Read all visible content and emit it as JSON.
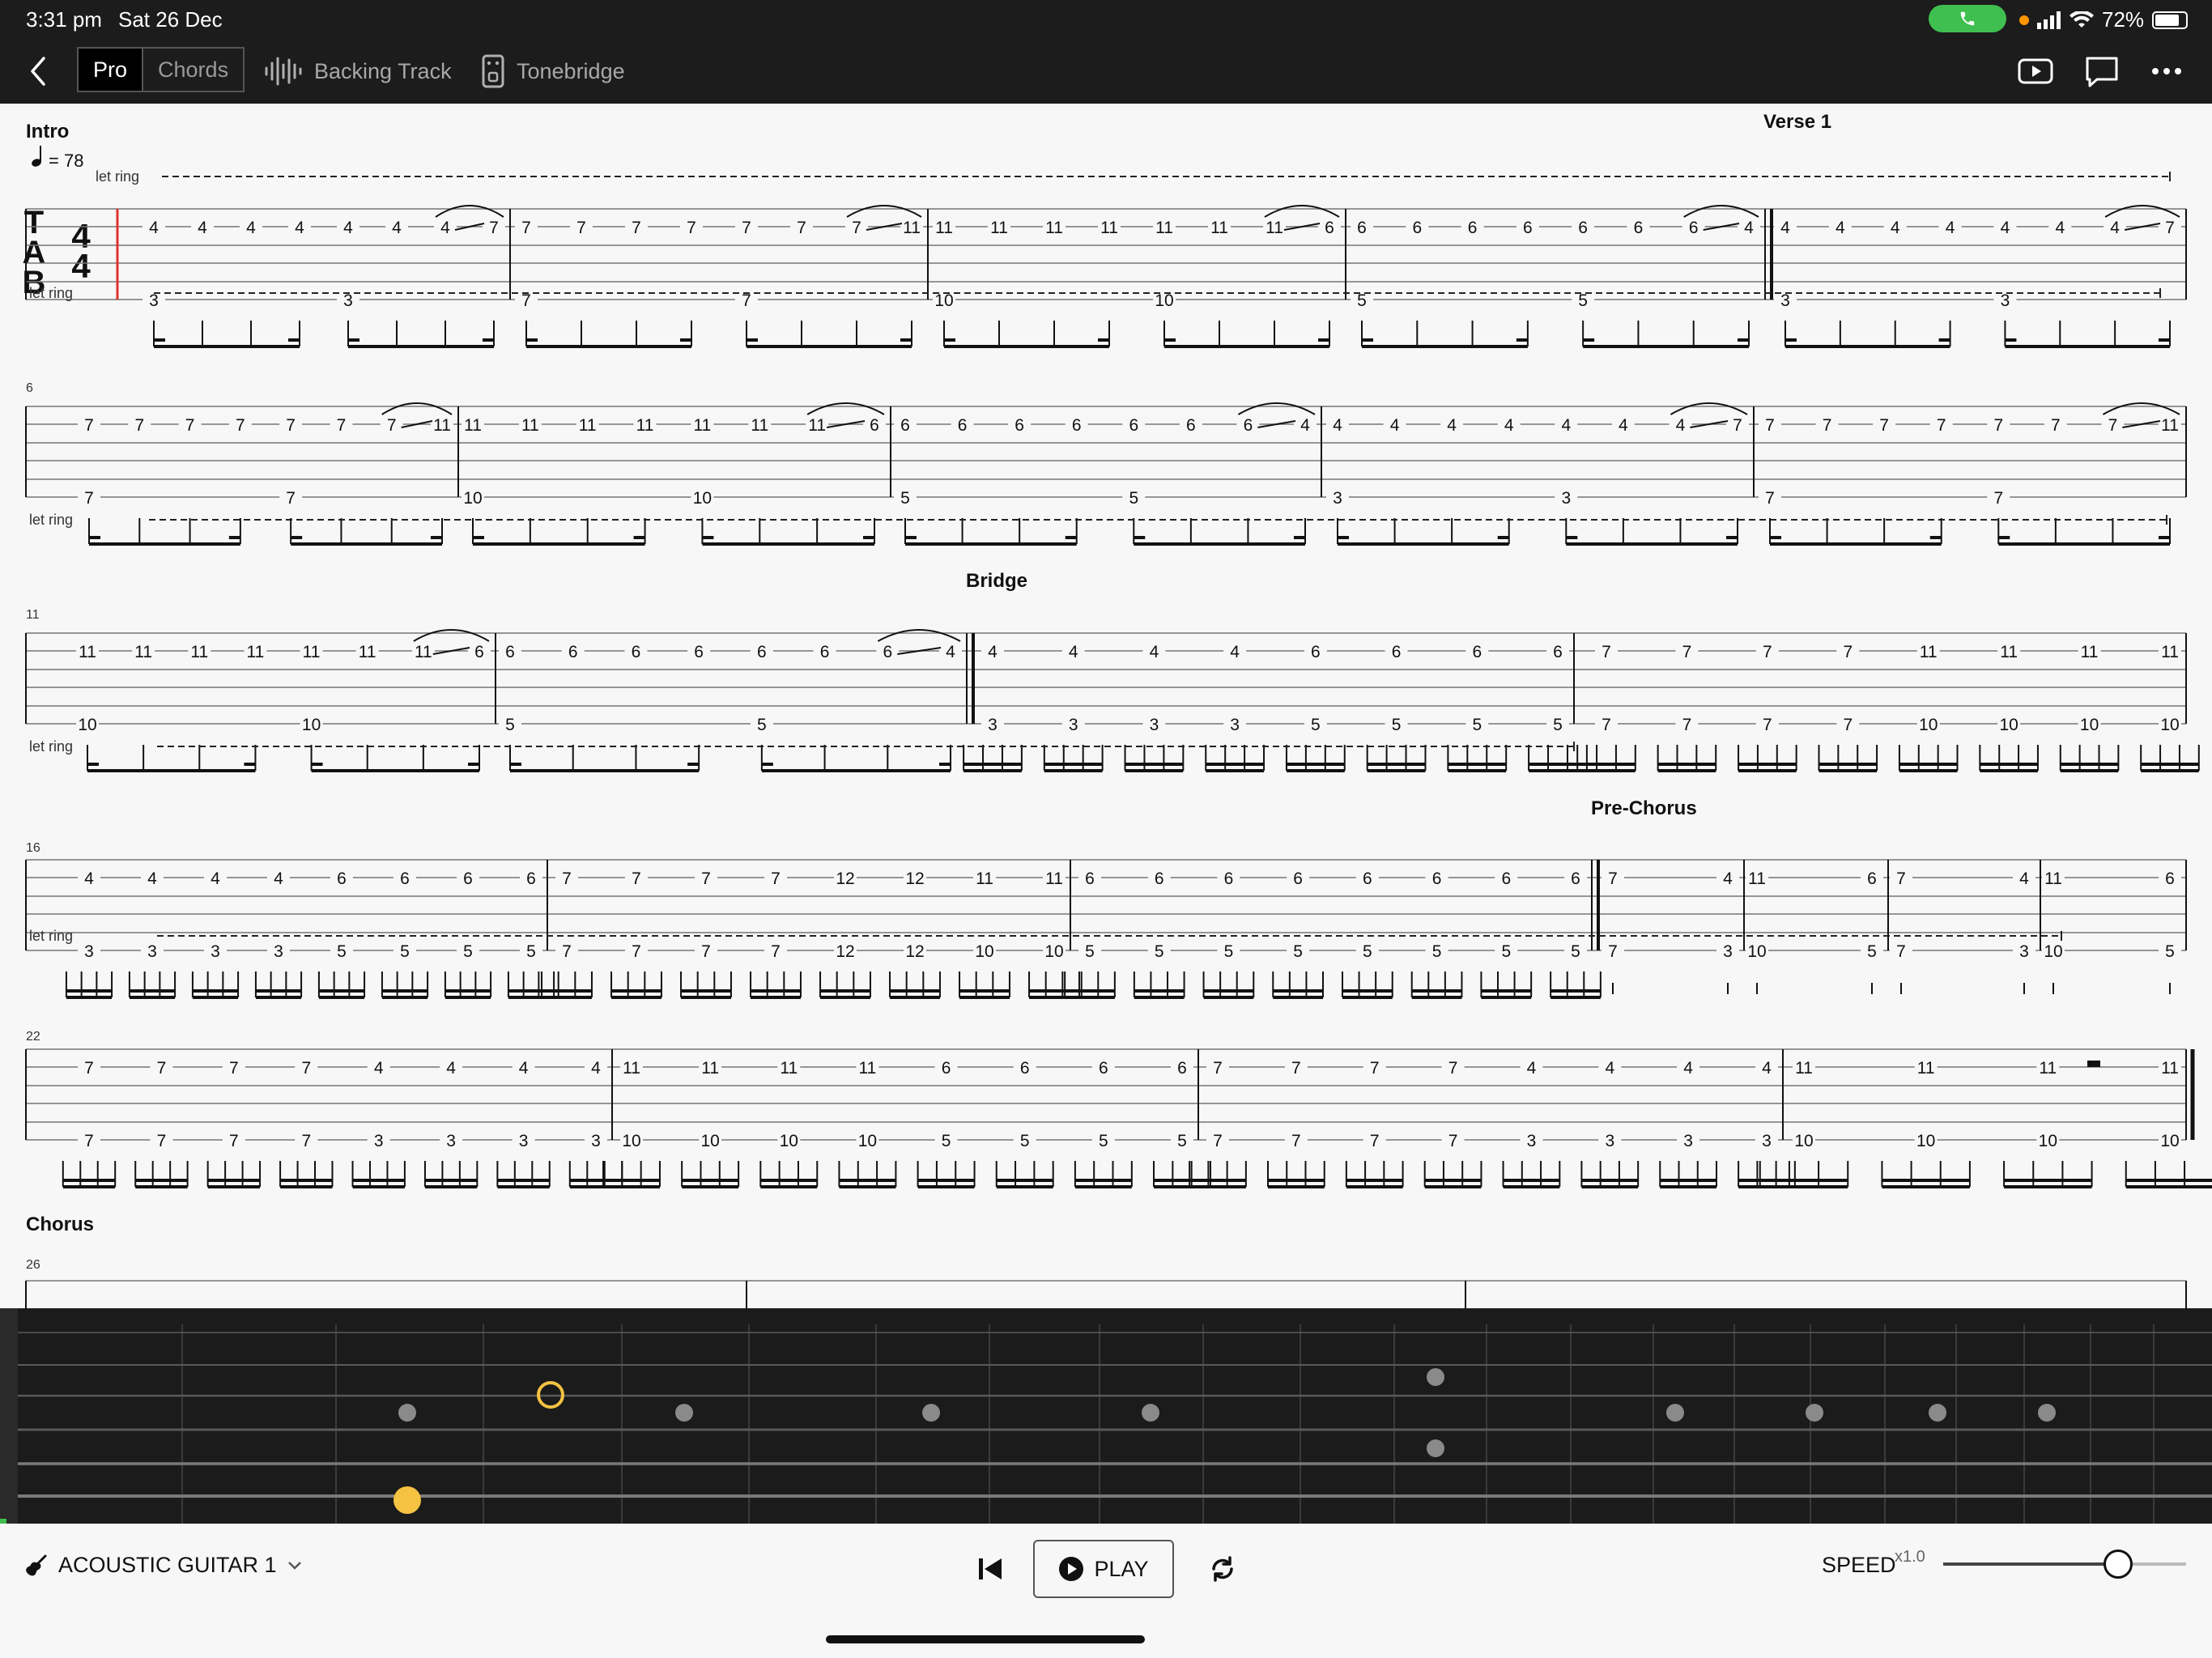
{
  "status_bar": {
    "time": "3:31 pm",
    "date": "Sat 26 Dec",
    "battery": "72%",
    "battery_level": 0.72
  },
  "toolbar": {
    "tabs": [
      {
        "label": "Pro",
        "active": true
      },
      {
        "label": "Chords",
        "active": false
      }
    ],
    "backing_track": "Backing Track",
    "tonebridge": "Tonebridge"
  },
  "icons": [
    "back-icon",
    "waveform-icon",
    "pedal-icon",
    "video-icon",
    "comment-icon",
    "more-icon",
    "phone-icon",
    "wifi-icon",
    "signal-icon",
    "guitar-icon",
    "chevron-down-icon",
    "skip-back-icon",
    "play-icon",
    "loop-icon"
  ],
  "colors": {
    "bar_bg": "#1c1c1c",
    "accent_yellow": "#f5c242",
    "cursor_red": "#e0322d",
    "call_green": "#3fbf4f",
    "page_bg": "#f7f7f7"
  },
  "score": {
    "tempo": "= 78",
    "let_ring": "let ring",
    "tab_clef": [
      "T",
      "A",
      "B"
    ],
    "time_signature": [
      "4",
      "4"
    ],
    "sections": [
      "Intro",
      "Verse 1",
      "Bridge",
      "Pre-Chorus",
      "Chorus"
    ],
    "measure_numbers": [
      "6",
      "11",
      "16",
      "22",
      "26"
    ],
    "systems": [
      {
        "measures": [
          {
            "beats": [
              [
                "4",
                "3"
              ],
              [
                "4",
                ""
              ],
              [
                "4",
                ""
              ],
              [
                "4",
                ""
              ],
              [
                "4",
                "3"
              ],
              [
                "4",
                ""
              ],
              [
                "4",
                ""
              ],
              [
                "7",
                ""
              ]
            ],
            "slide": true
          },
          {
            "beats": [
              [
                "7",
                "7"
              ],
              [
                "7",
                ""
              ],
              [
                "7",
                ""
              ],
              [
                "7",
                ""
              ],
              [
                "7",
                "7"
              ],
              [
                "7",
                ""
              ],
              [
                "7",
                ""
              ],
              [
                "11",
                ""
              ]
            ],
            "slide": true
          },
          {
            "beats": [
              [
                "11",
                "10"
              ],
              [
                "11",
                ""
              ],
              [
                "11",
                ""
              ],
              [
                "11",
                ""
              ],
              [
                "11",
                "10"
              ],
              [
                "11",
                ""
              ],
              [
                "11",
                ""
              ],
              [
                "6",
                ""
              ]
            ],
            "slide": true
          },
          {
            "beats": [
              [
                "6",
                "5"
              ],
              [
                "6",
                ""
              ],
              [
                "6",
                ""
              ],
              [
                "6",
                ""
              ],
              [
                "6",
                "5"
              ],
              [
                "6",
                ""
              ],
              [
                "6",
                ""
              ],
              [
                "4",
                ""
              ]
            ],
            "slide": true
          },
          {
            "beats": [
              [
                "4",
                "3"
              ],
              [
                "4",
                ""
              ],
              [
                "4",
                ""
              ],
              [
                "4",
                ""
              ],
              [
                "4",
                "3"
              ],
              [
                "4",
                ""
              ],
              [
                "4",
                ""
              ],
              [
                "7",
                ""
              ]
            ],
            "slide": true
          }
        ]
      },
      {
        "measures": [
          {
            "beats": [
              [
                "7",
                "7"
              ],
              [
                "7",
                ""
              ],
              [
                "7",
                ""
              ],
              [
                "7",
                ""
              ],
              [
                "7",
                "7"
              ],
              [
                "7",
                ""
              ],
              [
                "7",
                ""
              ],
              [
                "11",
                ""
              ]
            ],
            "slide": true
          },
          {
            "beats": [
              [
                "11",
                "10"
              ],
              [
                "11",
                ""
              ],
              [
                "11",
                ""
              ],
              [
                "11",
                ""
              ],
              [
                "11",
                "10"
              ],
              [
                "11",
                ""
              ],
              [
                "11",
                ""
              ],
              [
                "6",
                ""
              ]
            ],
            "slide": true
          },
          {
            "beats": [
              [
                "6",
                "5"
              ],
              [
                "6",
                ""
              ],
              [
                "6",
                ""
              ],
              [
                "6",
                ""
              ],
              [
                "6",
                "5"
              ],
              [
                "6",
                ""
              ],
              [
                "6",
                ""
              ],
              [
                "4",
                ""
              ]
            ],
            "slide": true
          },
          {
            "beats": [
              [
                "4",
                "3"
              ],
              [
                "4",
                ""
              ],
              [
                "4",
                ""
              ],
              [
                "4",
                ""
              ],
              [
                "4",
                "3"
              ],
              [
                "4",
                ""
              ],
              [
                "4",
                ""
              ],
              [
                "7",
                ""
              ]
            ],
            "slide": true
          },
          {
            "beats": [
              [
                "7",
                "7"
              ],
              [
                "7",
                ""
              ],
              [
                "7",
                ""
              ],
              [
                "7",
                ""
              ],
              [
                "7",
                "7"
              ],
              [
                "7",
                ""
              ],
              [
                "7",
                ""
              ],
              [
                "11",
                ""
              ]
            ],
            "slide": true
          }
        ]
      },
      {
        "measures": [
          {
            "beats": [
              [
                "11",
                "10"
              ],
              [
                "11",
                ""
              ],
              [
                "11",
                ""
              ],
              [
                "11",
                ""
              ],
              [
                "11",
                "10"
              ],
              [
                "11",
                ""
              ],
              [
                "11",
                ""
              ],
              [
                "6",
                ""
              ]
            ],
            "slide": true
          },
          {
            "beats": [
              [
                "6",
                "5"
              ],
              [
                "6",
                ""
              ],
              [
                "6",
                ""
              ],
              [
                "6",
                ""
              ],
              [
                "6",
                "5"
              ],
              [
                "6",
                ""
              ],
              [
                "6",
                ""
              ],
              [
                "4",
                ""
              ]
            ],
            "slide": true
          },
          {
            "beats": [
              [
                "4",
                "3"
              ],
              [
                "4",
                "3"
              ],
              [
                "4",
                "3"
              ],
              [
                "4",
                "3"
              ],
              [
                "6",
                "5"
              ],
              [
                "6",
                "5"
              ],
              [
                "6",
                "5"
              ],
              [
                "6",
                "5"
              ]
            ],
            "slide": false
          },
          {
            "beats": [
              [
                "7",
                "7"
              ],
              [
                "7",
                "7"
              ],
              [
                "7",
                "7"
              ],
              [
                "7",
                "7"
              ],
              [
                "11",
                "10"
              ],
              [
                "11",
                "10"
              ],
              [
                "11",
                "10"
              ],
              [
                "11",
                "10"
              ]
            ],
            "slide": false
          }
        ]
      },
      {
        "measures": [
          {
            "beats": [
              [
                "4",
                "3"
              ],
              [
                "4",
                "3"
              ],
              [
                "4",
                "3"
              ],
              [
                "4",
                "3"
              ],
              [
                "6",
                "5"
              ],
              [
                "6",
                "5"
              ],
              [
                "6",
                "5"
              ],
              [
                "6",
                "5"
              ]
            ],
            "slide": false
          },
          {
            "beats": [
              [
                "7",
                "7"
              ],
              [
                "7",
                "7"
              ],
              [
                "7",
                "7"
              ],
              [
                "7",
                "7"
              ],
              [
                "12",
                "12"
              ],
              [
                "12",
                "12"
              ],
              [
                "11",
                "10"
              ],
              [
                "11",
                "10"
              ]
            ],
            "slide": false
          },
          {
            "beats": [
              [
                "6",
                "5"
              ],
              [
                "6",
                "5"
              ],
              [
                "6",
                "5"
              ],
              [
                "6",
                "5"
              ],
              [
                "6",
                "5"
              ],
              [
                "6",
                "5"
              ],
              [
                "6",
                "5"
              ],
              [
                "6",
                "5"
              ]
            ],
            "slide": false
          },
          {
            "beats": [
              [
                "7",
                "7"
              ],
              [
                "4",
                "3"
              ]
            ],
            "slide": false
          },
          {
            "beats": [
              [
                "11",
                "10"
              ],
              [
                "6",
                "5"
              ]
            ],
            "slide": false
          },
          {
            "beats": [
              [
                "7",
                "7"
              ],
              [
                "4",
                "3"
              ]
            ],
            "slide": false
          },
          {
            "beats": [
              [
                "11",
                "10"
              ],
              [
                "6",
                "5"
              ]
            ],
            "slide": false
          }
        ]
      },
      {
        "measures": [
          {
            "beats": [
              [
                "7",
                "7"
              ],
              [
                "7",
                "7"
              ],
              [
                "7",
                "7"
              ],
              [
                "7",
                "7"
              ],
              [
                "4",
                "3"
              ],
              [
                "4",
                "3"
              ],
              [
                "4",
                "3"
              ],
              [
                "4",
                "3"
              ]
            ],
            "slide": false
          },
          {
            "beats": [
              [
                "11",
                "10"
              ],
              [
                "11",
                "10"
              ],
              [
                "11",
                "10"
              ],
              [
                "11",
                "10"
              ],
              [
                "6",
                "5"
              ],
              [
                "6",
                "5"
              ],
              [
                "6",
                "5"
              ],
              [
                "6",
                "5"
              ]
            ],
            "slide": false
          },
          {
            "beats": [
              [
                "7",
                "7"
              ],
              [
                "7",
                "7"
              ],
              [
                "7",
                "7"
              ],
              [
                "7",
                "7"
              ],
              [
                "4",
                "3"
              ],
              [
                "4",
                "3"
              ],
              [
                "4",
                "3"
              ],
              [
                "4",
                "3"
              ]
            ],
            "slide": false
          },
          {
            "beats": [
              [
                "11",
                "10"
              ],
              [
                "11",
                "10"
              ],
              [
                "11",
                "10"
              ],
              [
                "11",
                "10"
              ]
            ],
            "slide": false
          }
        ]
      }
    ]
  },
  "fretboard": {
    "string_count": 6
  },
  "bottom_bar": {
    "instrument": "ACOUSTIC GUITAR 1",
    "play_label": "PLAY",
    "speed_label": "SPEED",
    "speed_value": "x1.0",
    "speed_level": 0.72
  }
}
